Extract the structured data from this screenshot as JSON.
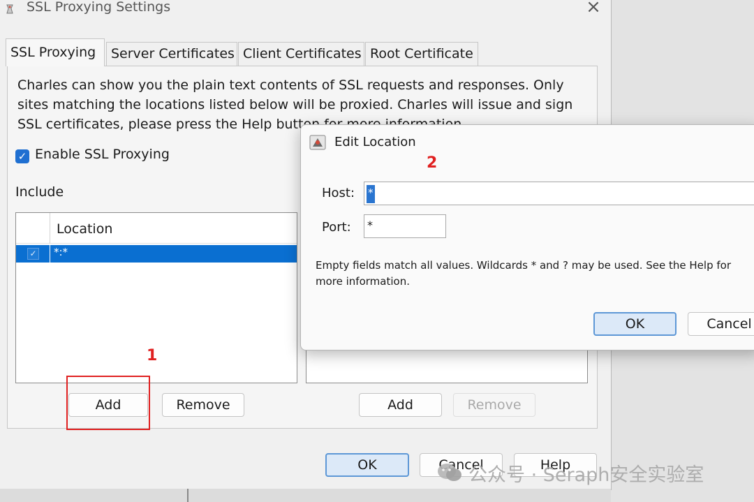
{
  "window": {
    "title": "SSL Proxying Settings",
    "tabs": [
      {
        "label": "SSL Proxying"
      },
      {
        "label": "Server Certificates"
      },
      {
        "label": "Client Certificates"
      },
      {
        "label": "Root Certificate"
      }
    ],
    "description_lines": [
      "Charles can show you the plain text contents of SSL requests and responses. Only",
      "sites matching the locations listed below will be proxied. Charles will issue and sign",
      "SSL certificates, please press the Help button for more information."
    ],
    "enable_label": "Enable SSL Proxying",
    "enable_checked": true,
    "include_label": "Include",
    "location_header": "Location",
    "locations": [
      {
        "checked": true,
        "value": "*:*"
      }
    ],
    "include_add": "Add",
    "include_remove": "Remove",
    "exclude_add": "Add",
    "exclude_remove": "Remove",
    "ok_label": "OK",
    "cancel_label": "Cancel",
    "help_label": "Help"
  },
  "dialog": {
    "title": "Edit Location",
    "host_label": "Host:",
    "host_value": "*",
    "port_label": "Port:",
    "port_value": "*",
    "info_lines": [
      "Empty fields match all values. Wildcards * and ? may be used. See the Help for",
      "more information."
    ],
    "ok_label": "OK",
    "cancel_label": "Cancel"
  },
  "annotations": {
    "marker_1": "1",
    "marker_2": "2",
    "color": "#e02020"
  },
  "watermark": {
    "text": "公众号 · Seraph安全实验室"
  },
  "colors": {
    "accent": "#0a6fd1",
    "checkbox": "#1f6fd1"
  }
}
